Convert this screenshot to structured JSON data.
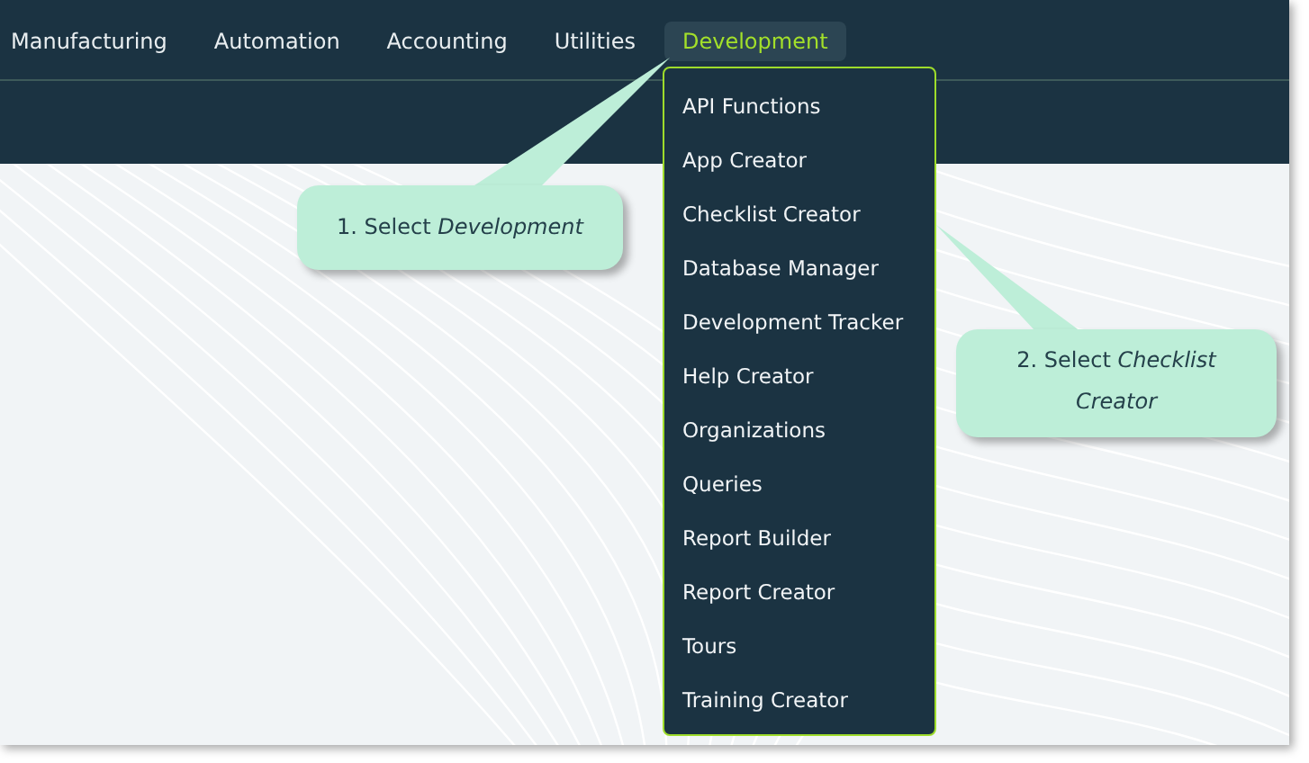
{
  "nav": {
    "items": [
      {
        "label": "Manufacturing",
        "selected": false
      },
      {
        "label": "Automation",
        "selected": false
      },
      {
        "label": "Accounting",
        "selected": false
      },
      {
        "label": "Utilities",
        "selected": false
      },
      {
        "label": "Development",
        "selected": true
      }
    ]
  },
  "dropdown": {
    "items": [
      {
        "label": "API Functions"
      },
      {
        "label": "App Creator"
      },
      {
        "label": "Checklist Creator"
      },
      {
        "label": "Database Manager"
      },
      {
        "label": "Development Tracker"
      },
      {
        "label": "Help Creator"
      },
      {
        "label": "Organizations"
      },
      {
        "label": "Queries"
      },
      {
        "label": "Report Builder"
      },
      {
        "label": "Report Creator"
      },
      {
        "label": "Tours"
      },
      {
        "label": "Training Creator"
      }
    ]
  },
  "callouts": [
    {
      "text": "1. Select *Development*"
    },
    {
      "text": "2. Select *Checklist Creator*"
    }
  ]
}
